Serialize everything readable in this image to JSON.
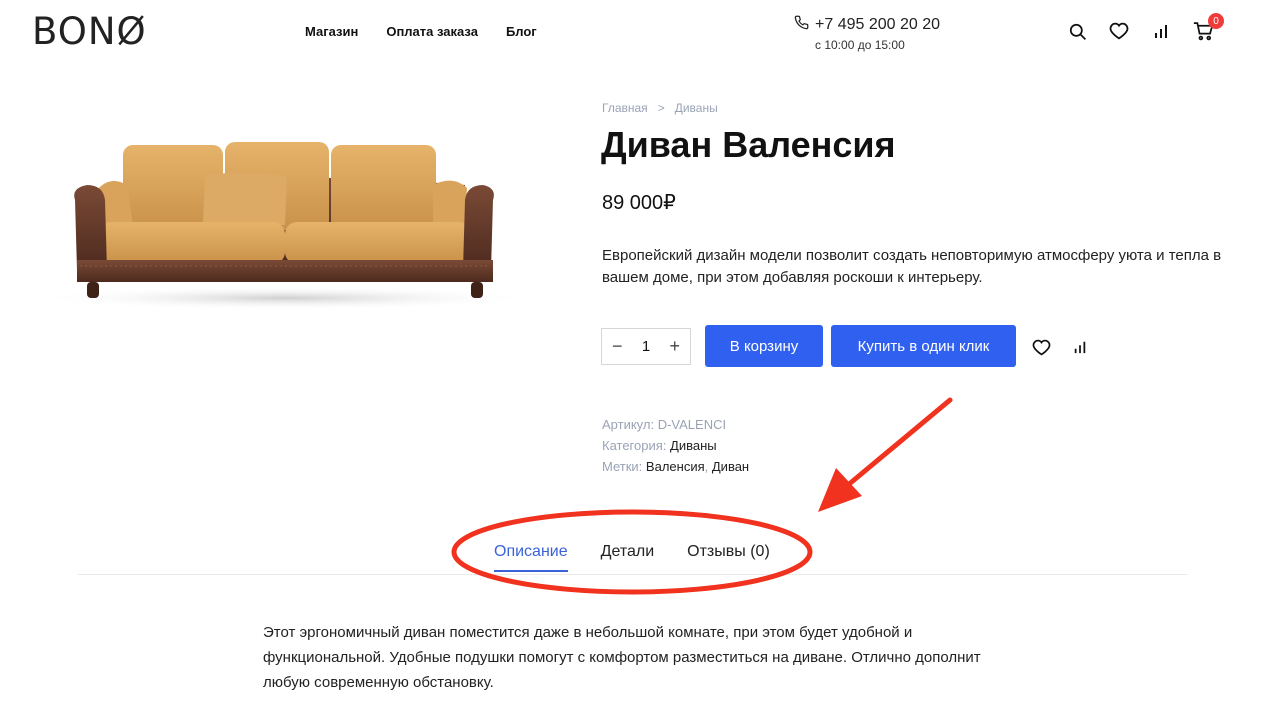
{
  "header": {
    "logo": "BONØ",
    "nav": [
      "Магазин",
      "Оплата заказа",
      "Блог"
    ],
    "phone": "+7 495 200 20 20",
    "hours": "с 10:00 до 15:00",
    "cart_count": "0"
  },
  "breadcrumb": {
    "home": "Главная",
    "separator": ">",
    "current": "Диваны"
  },
  "product": {
    "title": "Диван Валенсия",
    "price": "89 000₽",
    "description": "Европейский дизайн модели позволит создать неповторимую атмосферу уюта и тепла в вашем доме, при этом добавляя роскоши к интерьеру.",
    "quantity": "1",
    "qty_minus": "−",
    "qty_plus": "+",
    "add_to_cart": "В корзину",
    "buy_one_click": "Купить в один клик"
  },
  "meta": {
    "sku_label": "Артикул:",
    "sku_value": "D-VALENCI",
    "category_label": "Категория:",
    "category_value": "Диваны",
    "tags_label": "Метки:",
    "tag1": "Валенсия",
    "tag_sep": ",",
    "tag2": "Диван"
  },
  "tabs": [
    "Описание",
    "Детали",
    "Отзывы (0)"
  ],
  "tab_content": "Этот эргономичный диван поместится даже в небольшой комнате, при этом будет удобной и функциональной. Удобные подушки помогут с комфортом разместиться на диване. Отлично дополнит любую современную обстановку.",
  "colors": {
    "accent": "#3060f0",
    "annotation": "#f0321e",
    "muted": "#9aa3b5"
  }
}
